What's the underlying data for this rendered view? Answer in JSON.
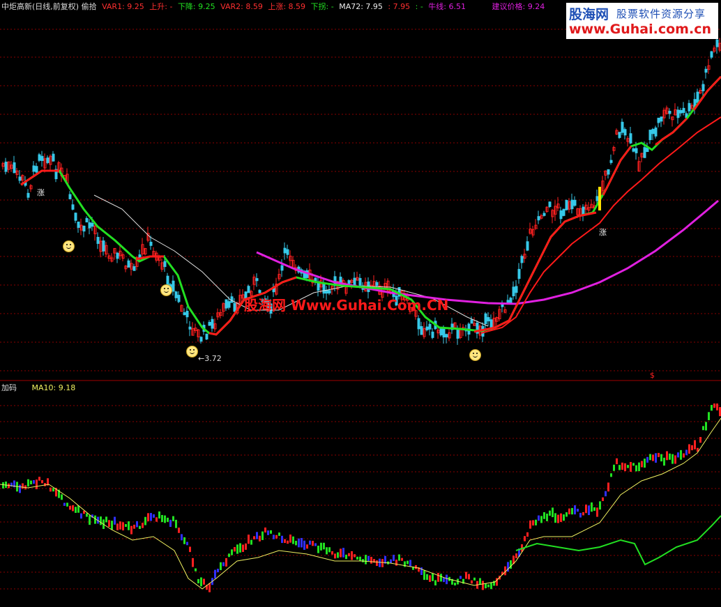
{
  "header": {
    "title": "中炬高新(日线,前复权) 偷拾",
    "var1": "VAR1: 9.25",
    "shangsheng": "上升: -",
    "xiajiang": "下降: 9.25",
    "var2": "VAR2: 8.59",
    "shangzhang": "上涨: 8.59",
    "xiaguai": "下拐: -",
    "ma72": "MA72: 7.95",
    "ma72b": ": 7.95",
    "dash": ": -",
    "niuxian": "牛线: 6.51",
    "jianyi": "建议价格: 9.24"
  },
  "sub_header": {
    "name": "加码",
    "ma10": "MA10: 9.18"
  },
  "logo": {
    "line1": "股海网",
    "line1b": "股票软件资源分享",
    "line2": "www.Guhai.com.cn"
  },
  "watermark": "股海网 Www.Guhai.Com.CN",
  "annotations": {
    "zhang1": "涨",
    "zhang2": "涨",
    "low": "←3.72",
    "dollar": "$"
  },
  "colors": {
    "background": "#000000",
    "up_candle": "#ff2020",
    "down_candle": "#36c8e8",
    "red_line": "#ff1a1a",
    "green_line": "#22e022",
    "magenta_line": "#e020e0",
    "white_line": "#e0e0e0",
    "grid": "#8b0000",
    "yellow_line": "#f0f060",
    "blue_bar": "#3030ff",
    "marker": "#ffe000"
  },
  "chart_data": {
    "type": "line",
    "panels": [
      {
        "name": "main",
        "series": [
          {
            "name": "VAR1",
            "last": 9.25
          },
          {
            "name": "VAR2",
            "last": 8.59
          },
          {
            "name": "MA72",
            "last": 7.95
          },
          {
            "name": "牛线",
            "last": 6.51
          }
        ],
        "low_annotation": 3.72,
        "suggested_price": 9.24
      },
      {
        "name": "加码",
        "series": [
          {
            "name": "MA10",
            "last": 9.18
          }
        ]
      }
    ]
  }
}
